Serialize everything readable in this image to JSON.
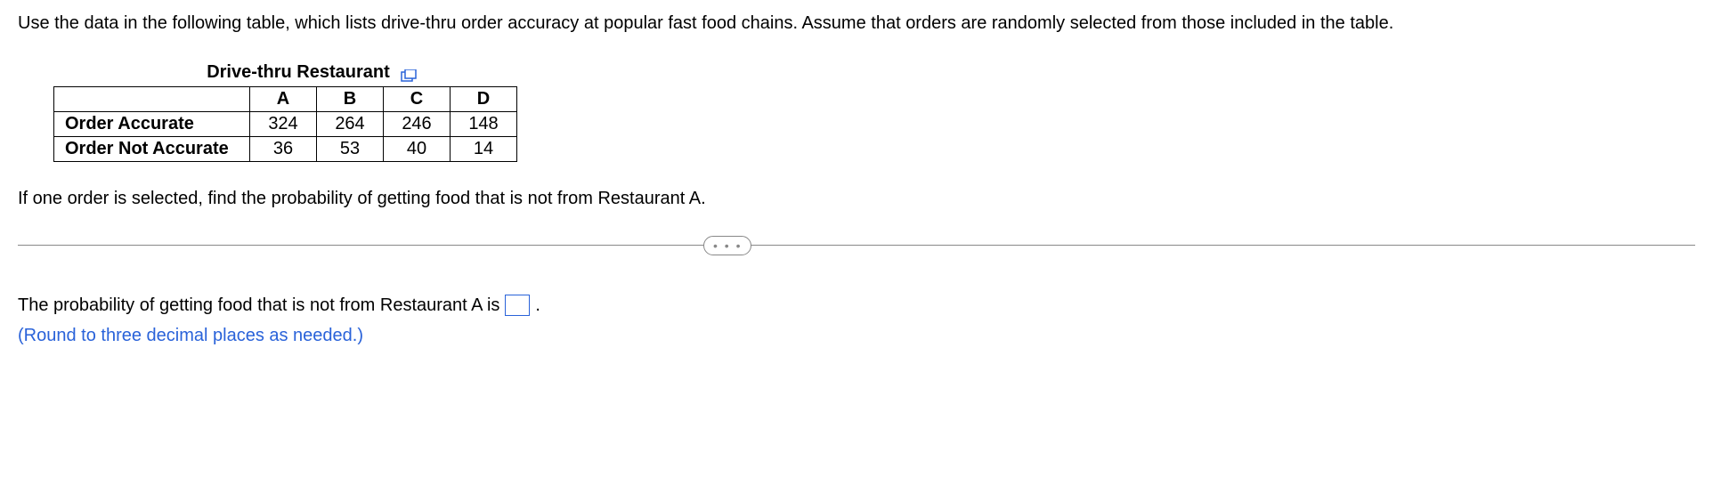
{
  "intro": "Use the data in the following table, which lists drive-thru order accuracy at popular fast food chains. Assume that orders are randomly selected from those included in the table.",
  "table": {
    "title": "Drive-thru Restaurant",
    "columns": [
      "A",
      "B",
      "C",
      "D"
    ],
    "rows": [
      {
        "label": "Order Accurate",
        "values": [
          "324",
          "264",
          "246",
          "148"
        ]
      },
      {
        "label": "Order Not Accurate",
        "values": [
          "36",
          "53",
          "40",
          "14"
        ]
      }
    ]
  },
  "question": "If one order is selected, find the probability of getting food that is not from Restaurant A.",
  "answer": {
    "prefix": "The probability of getting food that is not from Restaurant A is",
    "suffix": ".",
    "hint": "(Round to three decimal places as needed.)"
  },
  "divider_dots": "• • •"
}
